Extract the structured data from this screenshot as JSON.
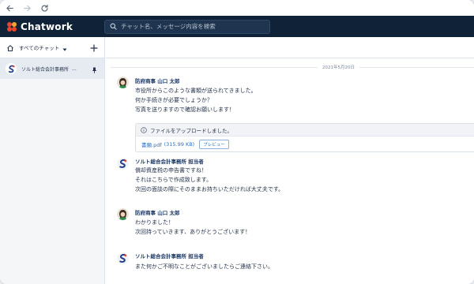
{
  "app": {
    "name": "Chatwork",
    "brand_color": "#0f2238",
    "logo_colors": [
      "#e8452c",
      "#f3a531"
    ]
  },
  "search": {
    "placeholder": "チャット名、メッセージ内容を検索"
  },
  "sidebar": {
    "filter_label": "すべてのチャット",
    "rooms": [
      {
        "name": "ソルト総合会計事務所",
        "ellipsis": "..."
      }
    ]
  },
  "timeline": {
    "date_label": "2021年5月20日",
    "messages": [
      {
        "sender": "防府商事 山口 太郎",
        "lines": [
          "市役所からこのような書類が送られてきました。",
          "何か手続きが必要でしょうか？",
          "写真を送りますので確認お願いします！"
        ]
      },
      {
        "sender": "ソルト総合会計事務所 担当者",
        "lines": [
          "償却資産税の申告書ですね！",
          "それはこちらで作成致します。",
          "次回の面談の際にそのままお持ちいただければ大丈夫です。"
        ]
      },
      {
        "sender": "防府商事 山口 太郎",
        "lines": [
          "わかりました！",
          "次回持っていきます、ありがとうございます！"
        ]
      },
      {
        "sender": "ソルト総合会計事務所 担当者",
        "lines": [
          "また何かご不明なことがございましたらご連絡下さい。"
        ]
      }
    ],
    "file_upload": {
      "notice": "ファイルをアップロードしました。",
      "file_name": "書類.pdf",
      "file_size": "(315.99 KB)",
      "preview_label": "プレビュー"
    }
  }
}
